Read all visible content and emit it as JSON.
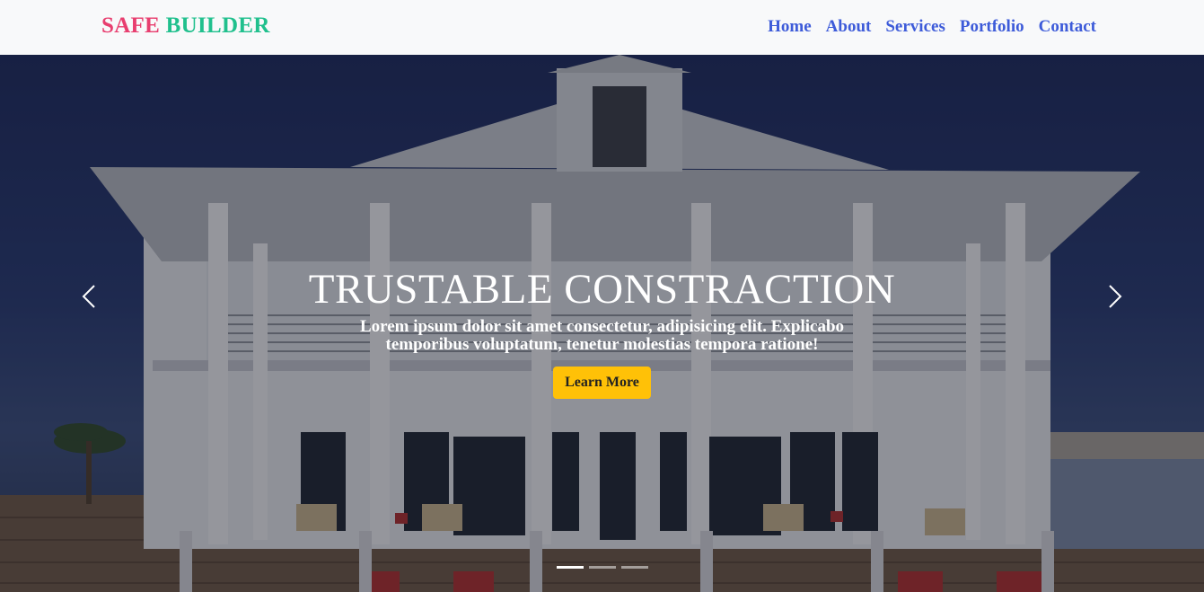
{
  "brand": {
    "part1": "SAFE",
    "part2": "BUILDER"
  },
  "nav": {
    "items": [
      "Home",
      "About",
      "Services",
      "Portfolio",
      "Contact"
    ]
  },
  "hero": {
    "title": "TRUSTABLE CONSTRACTION",
    "text": "Lorem ipsum dolor sit amet consectetur, adipisicing elit. Explicabo temporibus voluptatum, tenetur molestias tempora ratione!",
    "button": "Learn More",
    "slides": 3,
    "active_slide": 1
  },
  "icons": {
    "prev": "chevron-left-icon",
    "next": "chevron-right-icon"
  },
  "colors": {
    "brand_part1": "#e83e6f",
    "brand_part2": "#20c08d",
    "nav_link": "#3d5bd9",
    "button": "#ffc107"
  }
}
